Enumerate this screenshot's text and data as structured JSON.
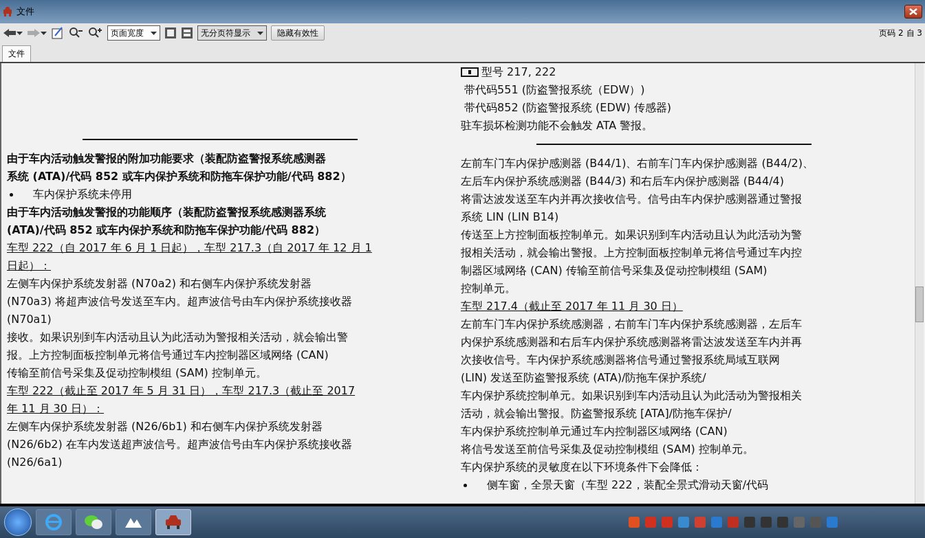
{
  "window": {
    "title": "文件"
  },
  "toolbar": {
    "zoom_select": "页面宽度",
    "pagebreak_select": "无分页符显示",
    "button": "隐藏有效性",
    "page_indicator": "页码 2 自 3"
  },
  "tabs": [
    {
      "label": "文件",
      "selected": true
    }
  ],
  "document": {
    "left": [
      {
        "kind": "rule"
      },
      {
        "kind": "heading",
        "lines": [
          "由于车内活动触发警报的附加功能要求（装配防盗警报系统感测器",
          "系统 (ATA)/代码 852 或车内保护系统和防拖车保护功能/代码 882）"
        ]
      },
      {
        "kind": "bullet",
        "lines": [
          "车内保护系统未停用"
        ]
      },
      {
        "kind": "heading",
        "lines": [
          "由于车内活动触发警报的功能顺序（装配防盗警报系统感测器系统",
          "(ATA)/代码 852 或车内保护系统和防拖车保护功能/代码 882）"
        ]
      },
      {
        "kind": "model",
        "lines": [
          "车型 222（自 2017 年 6 月 1 日起），车型 217.3（自 2017 年 12 月 1",
          "日起）："
        ]
      },
      {
        "kind": "para",
        "lines": [
          "左侧车内保护系统发射器 (N70a2) 和右侧车内保护系统发射器",
          "(N70a3) 将超声波信号发送至车内。超声波信号由车内保护系统接收器",
          "(N70a1)",
          "接收。如果识别到车内活动且认为此活动为警报相关活动，就会输出警",
          "报。上方控制面板控制单元将信号通过车内控制器区域网络 (CAN)",
          "传输至前信号采集及促动控制模组 (SAM) 控制单元。"
        ]
      },
      {
        "kind": "model",
        "lines": [
          "车型 222（截止至 2017 年 5 月 31 日），车型 217.3（截止至 2017",
          "年 11 月 30 日）："
        ]
      },
      {
        "kind": "para",
        "lines": [
          "左侧车内保护系统发射器 (N26/6b1) 和右侧车内保护系统发射器",
          "(N26/6b2) 在车内发送超声波信号。超声波信号由车内保护系统接收器",
          "(N26/6a1)"
        ]
      }
    ],
    "right": [
      {
        "kind": "note",
        "lines": [
          "型号 217, 222"
        ]
      },
      {
        "kind": "para",
        "lines": [
          " 带代码551 (防盗警报系统（EDW）)",
          " 带代码852 (防盗警报系统 (EDW) 传感器)",
          "驻车损坏检测功能不会触发 ATA 警报。"
        ]
      },
      {
        "kind": "rule"
      },
      {
        "kind": "para",
        "lines": [
          "左前车门车内保护感测器 (B44/1)、右前车门车内保护感测器 (B44/2)、",
          "左后车内保护系统感测器 (B44/3) 和右后车内保护感测器 (B44/4)",
          "将雷达波发送至车内并再次接收信号。信号由车内保护感测器通过警报",
          "系统 LIN (LIN B14)",
          "传送至上方控制面板控制单元。如果识别到车内活动且认为此活动为警",
          "报相关活动，就会输出警报。上方控制面板控制单元将信号通过车内控",
          "制器区域网络 (CAN) 传输至前信号采集及促动控制模组 (SAM)",
          "控制单元。"
        ]
      },
      {
        "kind": "model",
        "lines": [
          "车型 217.4（截止至 2017 年 11 月 30 日）"
        ]
      },
      {
        "kind": "para",
        "lines": [
          "左前车门车内保护系统感测器，右前车门车内保护系统感测器，左后车",
          "内保护系统感测器和右后车内保护系统感测器将雷达波发送至车内并再",
          "次接收信号。车内保护系统感测器将信号通过警报系统局域互联网",
          "(LIN) 发送至防盗警报系统 (ATA)/防拖车保护系统/",
          "车内保护系统控制单元。如果识别到车内活动且认为此活动为警报相关",
          "活动，就会输出警报。防盗警报系统 [ATA]/防拖车保护/",
          "车内保护系统控制单元通过车内控制器区域网络 (CAN)",
          "将信号发送至前信号采集及促动控制模组 (SAM) 控制单元。",
          "车内保护系统的灵敏度在以下环境条件下会降低："
        ]
      },
      {
        "kind": "bullet",
        "lines": [
          "侧车窗，全景天窗（车型 222，装配全景式滑动天窗/代码"
        ]
      }
    ]
  },
  "taskbar": {
    "apps": [
      {
        "kind": "browser",
        "selected": false
      },
      {
        "kind": "chat",
        "selected": false
      },
      {
        "kind": "cloud",
        "selected": false
      },
      {
        "kind": "car",
        "selected": true
      }
    ]
  }
}
